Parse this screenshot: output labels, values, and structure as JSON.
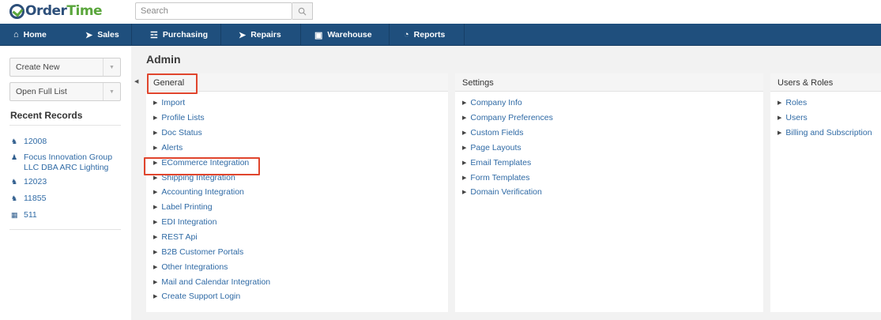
{
  "brand": {
    "logo_a": "Order",
    "logo_b": "Time"
  },
  "search": {
    "placeholder": "Search"
  },
  "nav": [
    {
      "label": "Home",
      "icon": "home-icon"
    },
    {
      "label": "Sales",
      "icon": "rocket-icon"
    },
    {
      "label": "Purchasing",
      "icon": "cart-icon"
    },
    {
      "label": "Repairs",
      "icon": "wrench-icon"
    },
    {
      "label": "Warehouse",
      "icon": "box-icon"
    },
    {
      "label": "Reports",
      "icon": "pie-chart-icon"
    }
  ],
  "sidebar": {
    "create_new": "Create New",
    "open_full_list": "Open Full List",
    "recent_title": "Recent Records",
    "recent": [
      {
        "label": "12008",
        "icon": "ship-icon"
      },
      {
        "label": "Focus Innovation Group LLC DBA ARC Lighting",
        "icon": "person-icon"
      },
      {
        "label": "12023",
        "icon": "ship-icon"
      },
      {
        "label": "11855",
        "icon": "ship-icon"
      },
      {
        "label": "511",
        "icon": "grid-icon"
      }
    ]
  },
  "page": {
    "title": "Admin"
  },
  "panels": {
    "general": {
      "title": "General",
      "items": [
        "Import",
        "Profile Lists",
        "Doc Status",
        "Alerts",
        "ECommerce Integration",
        "Shipping Integration",
        "Accounting Integration",
        "Label Printing",
        "EDI Integration",
        "REST Api",
        "B2B Customer Portals",
        "Other Integrations",
        "Mail and Calendar Integration",
        "Create Support Login"
      ]
    },
    "settings": {
      "title": "Settings",
      "items": [
        "Company Info",
        "Company Preferences",
        "Custom Fields",
        "Page Layouts",
        "Email Templates",
        "Form Templates",
        "Domain Verification"
      ]
    },
    "users": {
      "title": "Users & Roles",
      "items": [
        "Roles",
        "Users",
        "Billing and Subscription"
      ]
    }
  },
  "colors": {
    "nav_bg": "#1f4f7d",
    "link": "#2f6aa5",
    "highlight": "#e0452d",
    "brand_blue": "#2d4f7a",
    "brand_green": "#5aa63c"
  }
}
